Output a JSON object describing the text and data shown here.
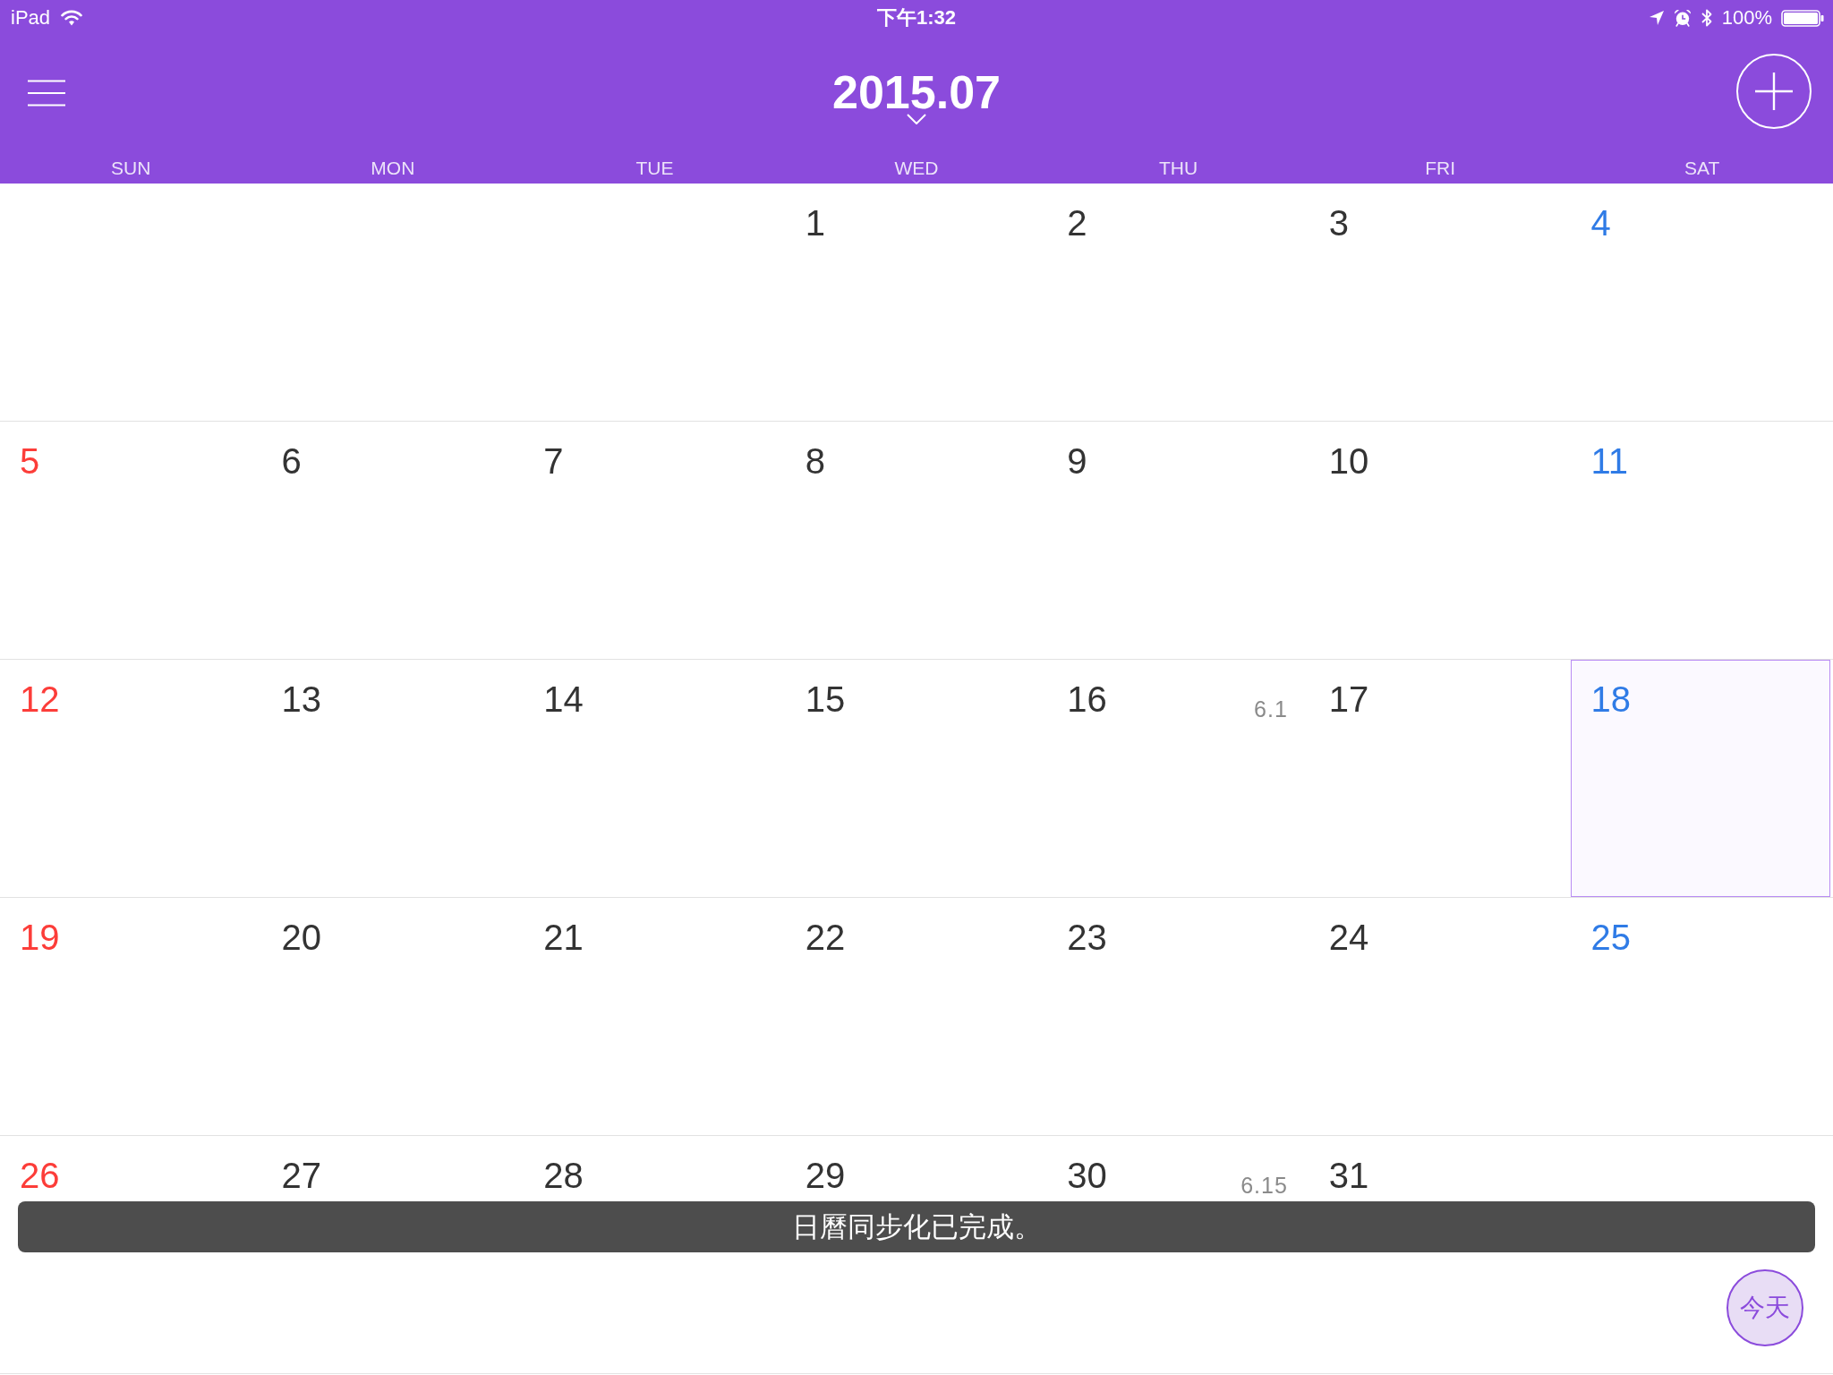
{
  "status_bar": {
    "device": "iPad",
    "time": "下午1:32",
    "battery": "100%"
  },
  "header": {
    "title": "2015.07"
  },
  "weekdays": [
    "SUN",
    "MON",
    "TUE",
    "WED",
    "THU",
    "FRI",
    "SAT"
  ],
  "calendar": {
    "weeks": [
      {
        "days": [
          {
            "kind": "blank"
          },
          {
            "kind": "blank"
          },
          {
            "kind": "blank"
          },
          {
            "kind": "date",
            "day": "1",
            "color": "#333333",
            "selected": false
          },
          {
            "kind": "date",
            "day": "2",
            "color": "#333333",
            "selected": false
          },
          {
            "kind": "date",
            "day": "3",
            "color": "#333333",
            "selected": false
          },
          {
            "kind": "date",
            "day": "4",
            "color": "#2f7be6",
            "selected": false
          }
        ]
      },
      {
        "days": [
          {
            "kind": "date",
            "day": "5",
            "color": "#fc3d39",
            "selected": false
          },
          {
            "kind": "date",
            "day": "6",
            "color": "#333333",
            "selected": false
          },
          {
            "kind": "date",
            "day": "7",
            "color": "#333333",
            "selected": false
          },
          {
            "kind": "date",
            "day": "8",
            "color": "#333333",
            "selected": false
          },
          {
            "kind": "date",
            "day": "9",
            "color": "#333333",
            "selected": false
          },
          {
            "kind": "date",
            "day": "10",
            "color": "#333333",
            "selected": false
          },
          {
            "kind": "date",
            "day": "11",
            "color": "#2f7be6",
            "selected": false
          }
        ]
      },
      {
        "days": [
          {
            "kind": "date",
            "day": "12",
            "color": "#fc3d39",
            "selected": false
          },
          {
            "kind": "date",
            "day": "13",
            "color": "#333333",
            "selected": false
          },
          {
            "kind": "date",
            "day": "14",
            "color": "#333333",
            "selected": false
          },
          {
            "kind": "date",
            "day": "15",
            "color": "#333333",
            "selected": false
          },
          {
            "kind": "date",
            "day": "16",
            "color": "#333333",
            "selected": false,
            "lunar": "6.1"
          },
          {
            "kind": "date",
            "day": "17",
            "color": "#333333",
            "selected": false
          },
          {
            "kind": "date",
            "day": "18",
            "color": "#2f7be6",
            "selected": true
          }
        ]
      },
      {
        "days": [
          {
            "kind": "date",
            "day": "19",
            "color": "#fc3d39",
            "selected": false
          },
          {
            "kind": "date",
            "day": "20",
            "color": "#333333",
            "selected": false
          },
          {
            "kind": "date",
            "day": "21",
            "color": "#333333",
            "selected": false
          },
          {
            "kind": "date",
            "day": "22",
            "color": "#333333",
            "selected": false
          },
          {
            "kind": "date",
            "day": "23",
            "color": "#333333",
            "selected": false
          },
          {
            "kind": "date",
            "day": "24",
            "color": "#333333",
            "selected": false
          },
          {
            "kind": "date",
            "day": "25",
            "color": "#2f7be6",
            "selected": false
          }
        ]
      },
      {
        "days": [
          {
            "kind": "date",
            "day": "26",
            "color": "#fc3d39",
            "selected": false
          },
          {
            "kind": "date",
            "day": "27",
            "color": "#333333",
            "selected": false
          },
          {
            "kind": "date",
            "day": "28",
            "color": "#333333",
            "selected": false
          },
          {
            "kind": "date",
            "day": "29",
            "color": "#333333",
            "selected": false
          },
          {
            "kind": "date",
            "day": "30",
            "color": "#333333",
            "selected": false,
            "lunar": "6.15"
          },
          {
            "kind": "date",
            "day": "31",
            "color": "#333333",
            "selected": false
          },
          {
            "kind": "blank"
          }
        ]
      }
    ]
  },
  "toast": {
    "message": "日曆同步化已完成。"
  },
  "today_button": {
    "label": "今天"
  }
}
